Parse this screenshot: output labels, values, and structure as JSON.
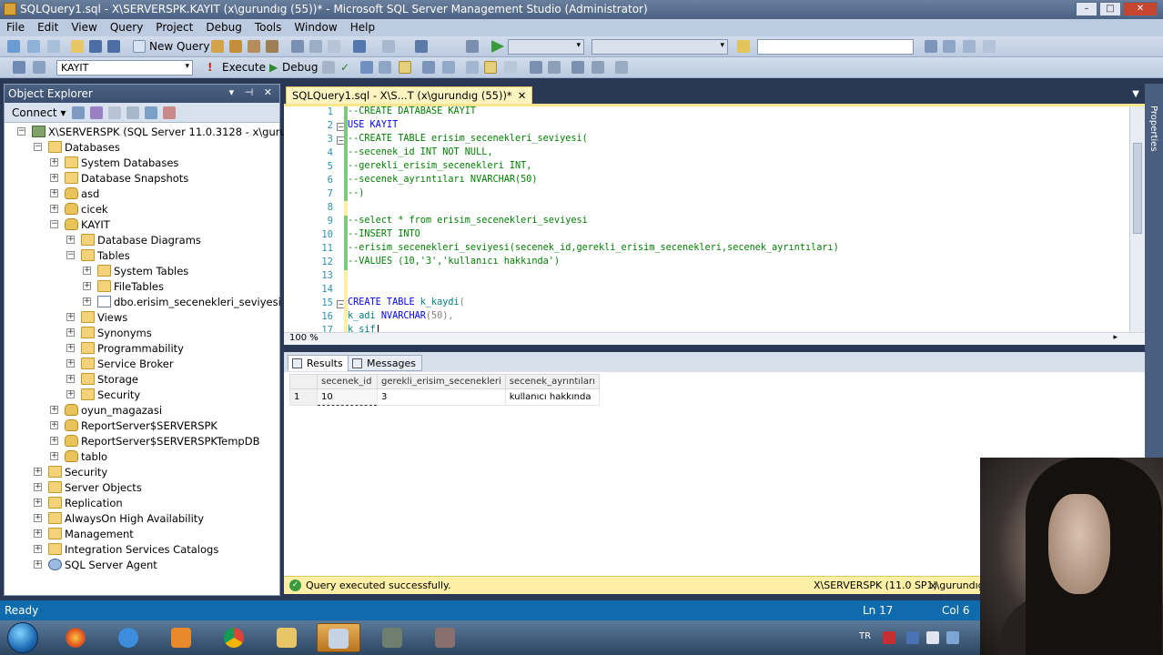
{
  "window": {
    "title": "SQLQuery1.sql - X\\SERVERSPK.KAYIT (x\\gurundıg (55))* - Microsoft SQL Server Management Studio (Administrator)"
  },
  "menu": [
    "File",
    "Edit",
    "View",
    "Query",
    "Project",
    "Debug",
    "Tools",
    "Window",
    "Help"
  ],
  "toolbar1": {
    "new_query_label": "New Query",
    "search_value": ""
  },
  "toolbar2": {
    "database_value": "KAYIT",
    "execute_label": "Execute",
    "debug_label": "Debug"
  },
  "object_explorer": {
    "title": "Object Explorer",
    "connect_label": "Connect",
    "nodes": [
      {
        "label": "X\\SERVERSPK (SQL Server 11.0.3128 - x\\gurundıg)",
        "exp": "-",
        "icon": "srv",
        "icon_name": "server-icon"
      },
      {
        "label": "Databases",
        "exp": "-",
        "icon": "folder",
        "icon_name": "folder-icon"
      },
      {
        "label": "System Databases",
        "exp": "+",
        "icon": "folder",
        "icon_name": "folder-icon"
      },
      {
        "label": "Database Snapshots",
        "exp": "+",
        "icon": "folder",
        "icon_name": "folder-icon"
      },
      {
        "label": "asd",
        "exp": "+",
        "icon": "db",
        "icon_name": "database-icon"
      },
      {
        "label": "cicek",
        "exp": "+",
        "icon": "db",
        "icon_name": "database-icon"
      },
      {
        "label": "KAYIT",
        "exp": "-",
        "icon": "db",
        "icon_name": "database-icon"
      },
      {
        "label": "Database Diagrams",
        "exp": "+",
        "icon": "folder",
        "icon_name": "folder-icon"
      },
      {
        "label": "Tables",
        "exp": "-",
        "icon": "folder",
        "icon_name": "folder-icon"
      },
      {
        "label": "System Tables",
        "exp": "+",
        "icon": "folder",
        "icon_name": "folder-icon"
      },
      {
        "label": "FileTables",
        "exp": "+",
        "icon": "folder",
        "icon_name": "folder-icon"
      },
      {
        "label": "dbo.erisim_secenekleri_seviyesi",
        "exp": "+",
        "icon": "tbl",
        "icon_name": "table-icon"
      },
      {
        "label": "Views",
        "exp": "+",
        "icon": "folder",
        "icon_name": "folder-icon"
      },
      {
        "label": "Synonyms",
        "exp": "+",
        "icon": "folder",
        "icon_name": "folder-icon"
      },
      {
        "label": "Programmability",
        "exp": "+",
        "icon": "folder",
        "icon_name": "folder-icon"
      },
      {
        "label": "Service Broker",
        "exp": "+",
        "icon": "folder",
        "icon_name": "folder-icon"
      },
      {
        "label": "Storage",
        "exp": "+",
        "icon": "folder",
        "icon_name": "folder-icon"
      },
      {
        "label": "Security",
        "exp": "+",
        "icon": "folder",
        "icon_name": "folder-icon"
      },
      {
        "label": "oyun_magazasi",
        "exp": "+",
        "icon": "db",
        "icon_name": "database-icon"
      },
      {
        "label": "ReportServer$SERVERSPK",
        "exp": "+",
        "icon": "db",
        "icon_name": "database-icon"
      },
      {
        "label": "ReportServer$SERVERSPKTempDB",
        "exp": "+",
        "icon": "db",
        "icon_name": "database-icon"
      },
      {
        "label": "tablo",
        "exp": "+",
        "icon": "db",
        "icon_name": "database-icon"
      },
      {
        "label": "Security",
        "exp": "+",
        "icon": "folder",
        "icon_name": "folder-icon"
      },
      {
        "label": "Server Objects",
        "exp": "+",
        "icon": "folder",
        "icon_name": "folder-icon"
      },
      {
        "label": "Replication",
        "exp": "+",
        "icon": "folder",
        "icon_name": "folder-icon"
      },
      {
        "label": "AlwaysOn High Availability",
        "exp": "+",
        "icon": "folder",
        "icon_name": "folder-icon"
      },
      {
        "label": "Management",
        "exp": "+",
        "icon": "folder",
        "icon_name": "folder-icon"
      },
      {
        "label": "Integration Services Catalogs",
        "exp": "+",
        "icon": "folder",
        "icon_name": "folder-icon"
      },
      {
        "label": "SQL Server Agent",
        "exp": "+",
        "icon": "agent",
        "icon_name": "agent-icon"
      }
    ]
  },
  "editor": {
    "tab_label": "SQLQuery1.sql - X\\S...T (x\\gurundıg (55))*",
    "zoom": "100 %",
    "lines": [
      {
        "n": "1",
        "tokens": [
          [
            "c-cmt",
            "--CREATE DATABASE KAYIT"
          ]
        ]
      },
      {
        "n": "2",
        "tokens": [
          [
            "c-kw",
            "USE "
          ],
          [
            "c-kw",
            "KAYIT"
          ]
        ]
      },
      {
        "n": "3",
        "tokens": [
          [
            "c-cmt",
            "--CREATE TABLE erisim_secenekleri_seviyesi("
          ]
        ]
      },
      {
        "n": "4",
        "tokens": [
          [
            "c-cmt",
            "--secenek_id INT NOT NULL,"
          ]
        ]
      },
      {
        "n": "5",
        "tokens": [
          [
            "c-cmt",
            "--gerekli_erisim_secenekleri INT,"
          ]
        ]
      },
      {
        "n": "6",
        "tokens": [
          [
            "c-cmt",
            "--secenek_ayrıntıları NVARCHAR(50)"
          ]
        ]
      },
      {
        "n": "7",
        "tokens": [
          [
            "c-cmt",
            "--)"
          ]
        ]
      },
      {
        "n": "8",
        "tokens": []
      },
      {
        "n": "9",
        "tokens": [
          [
            "c-cmt",
            "--select * from erisim_secenekleri_seviyesi"
          ]
        ]
      },
      {
        "n": "10",
        "tokens": [
          [
            "c-cmt",
            "--INSERT INTO"
          ]
        ]
      },
      {
        "n": "11",
        "tokens": [
          [
            "c-cmt",
            "--erisim_secenekleri_seviyesi(secenek_id,gerekli_erisim_secenekleri,secenek_ayrıntıları)"
          ]
        ]
      },
      {
        "n": "12",
        "tokens": [
          [
            "c-cmt",
            "--VALUES (10,'3','kullanıcı hakkında')"
          ]
        ]
      },
      {
        "n": "13",
        "tokens": []
      },
      {
        "n": "14",
        "tokens": []
      },
      {
        "n": "15",
        "tokens": [
          [
            "c-kw",
            "CREATE TABLE "
          ],
          [
            "c-id",
            "k_kaydi"
          ],
          [
            "c-gray",
            "("
          ]
        ]
      },
      {
        "n": "16",
        "tokens": [
          [
            "c-id",
            "k_adi "
          ],
          [
            "c-kw",
            "NVARCHAR"
          ],
          [
            "c-gray",
            "(50),"
          ]
        ]
      },
      {
        "n": "17",
        "tokens": [
          [
            "c-id",
            "k_sif"
          ]
        ]
      }
    ]
  },
  "results": {
    "tab_results": "Results",
    "tab_messages": "Messages",
    "columns": [
      "secenek_id",
      "gerekli_erisim_secenekleri",
      "secenek_ayrıntıları"
    ],
    "rows": [
      {
        "rn": "1",
        "cells": [
          "10",
          "3",
          "kullanıcı hakkında"
        ]
      }
    ]
  },
  "query_status": {
    "message": "Query executed successfully.",
    "server": "X\\SERVERSPK (11.0 SP1)",
    "user": "x\\gurundıg"
  },
  "properties_label": "Properties",
  "statusbar": {
    "ready": "Ready",
    "line": "Ln 17",
    "col": "Col 6"
  },
  "taskbar": {
    "language": "TR"
  }
}
